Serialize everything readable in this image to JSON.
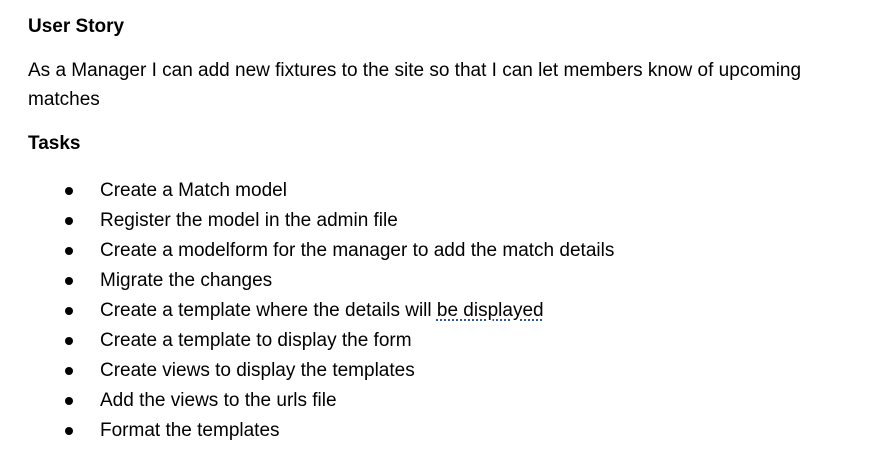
{
  "user_story": {
    "heading": "User Story",
    "text": "As a Manager I can add new fixtures to the site so that I can let members know of upcoming matches"
  },
  "tasks": {
    "heading": "Tasks",
    "items": [
      {
        "text": "Create a Match model"
      },
      {
        "text": "Register the model in the admin file"
      },
      {
        "text": "Create a modelform for the manager to add the match details"
      },
      {
        "text": "Migrate the changes"
      },
      {
        "text_before": "Create a template where the details will ",
        "text_flagged": "be displayed"
      },
      {
        "text": "Create a template to display the form"
      },
      {
        "text": "Create views to display the templates"
      },
      {
        "text": "Add the views to the urls file"
      },
      {
        "text": "Format the templates"
      }
    ]
  },
  "colors": {
    "text": "#000000",
    "grammar_underline": "#2b579a",
    "background": "#ffffff"
  }
}
